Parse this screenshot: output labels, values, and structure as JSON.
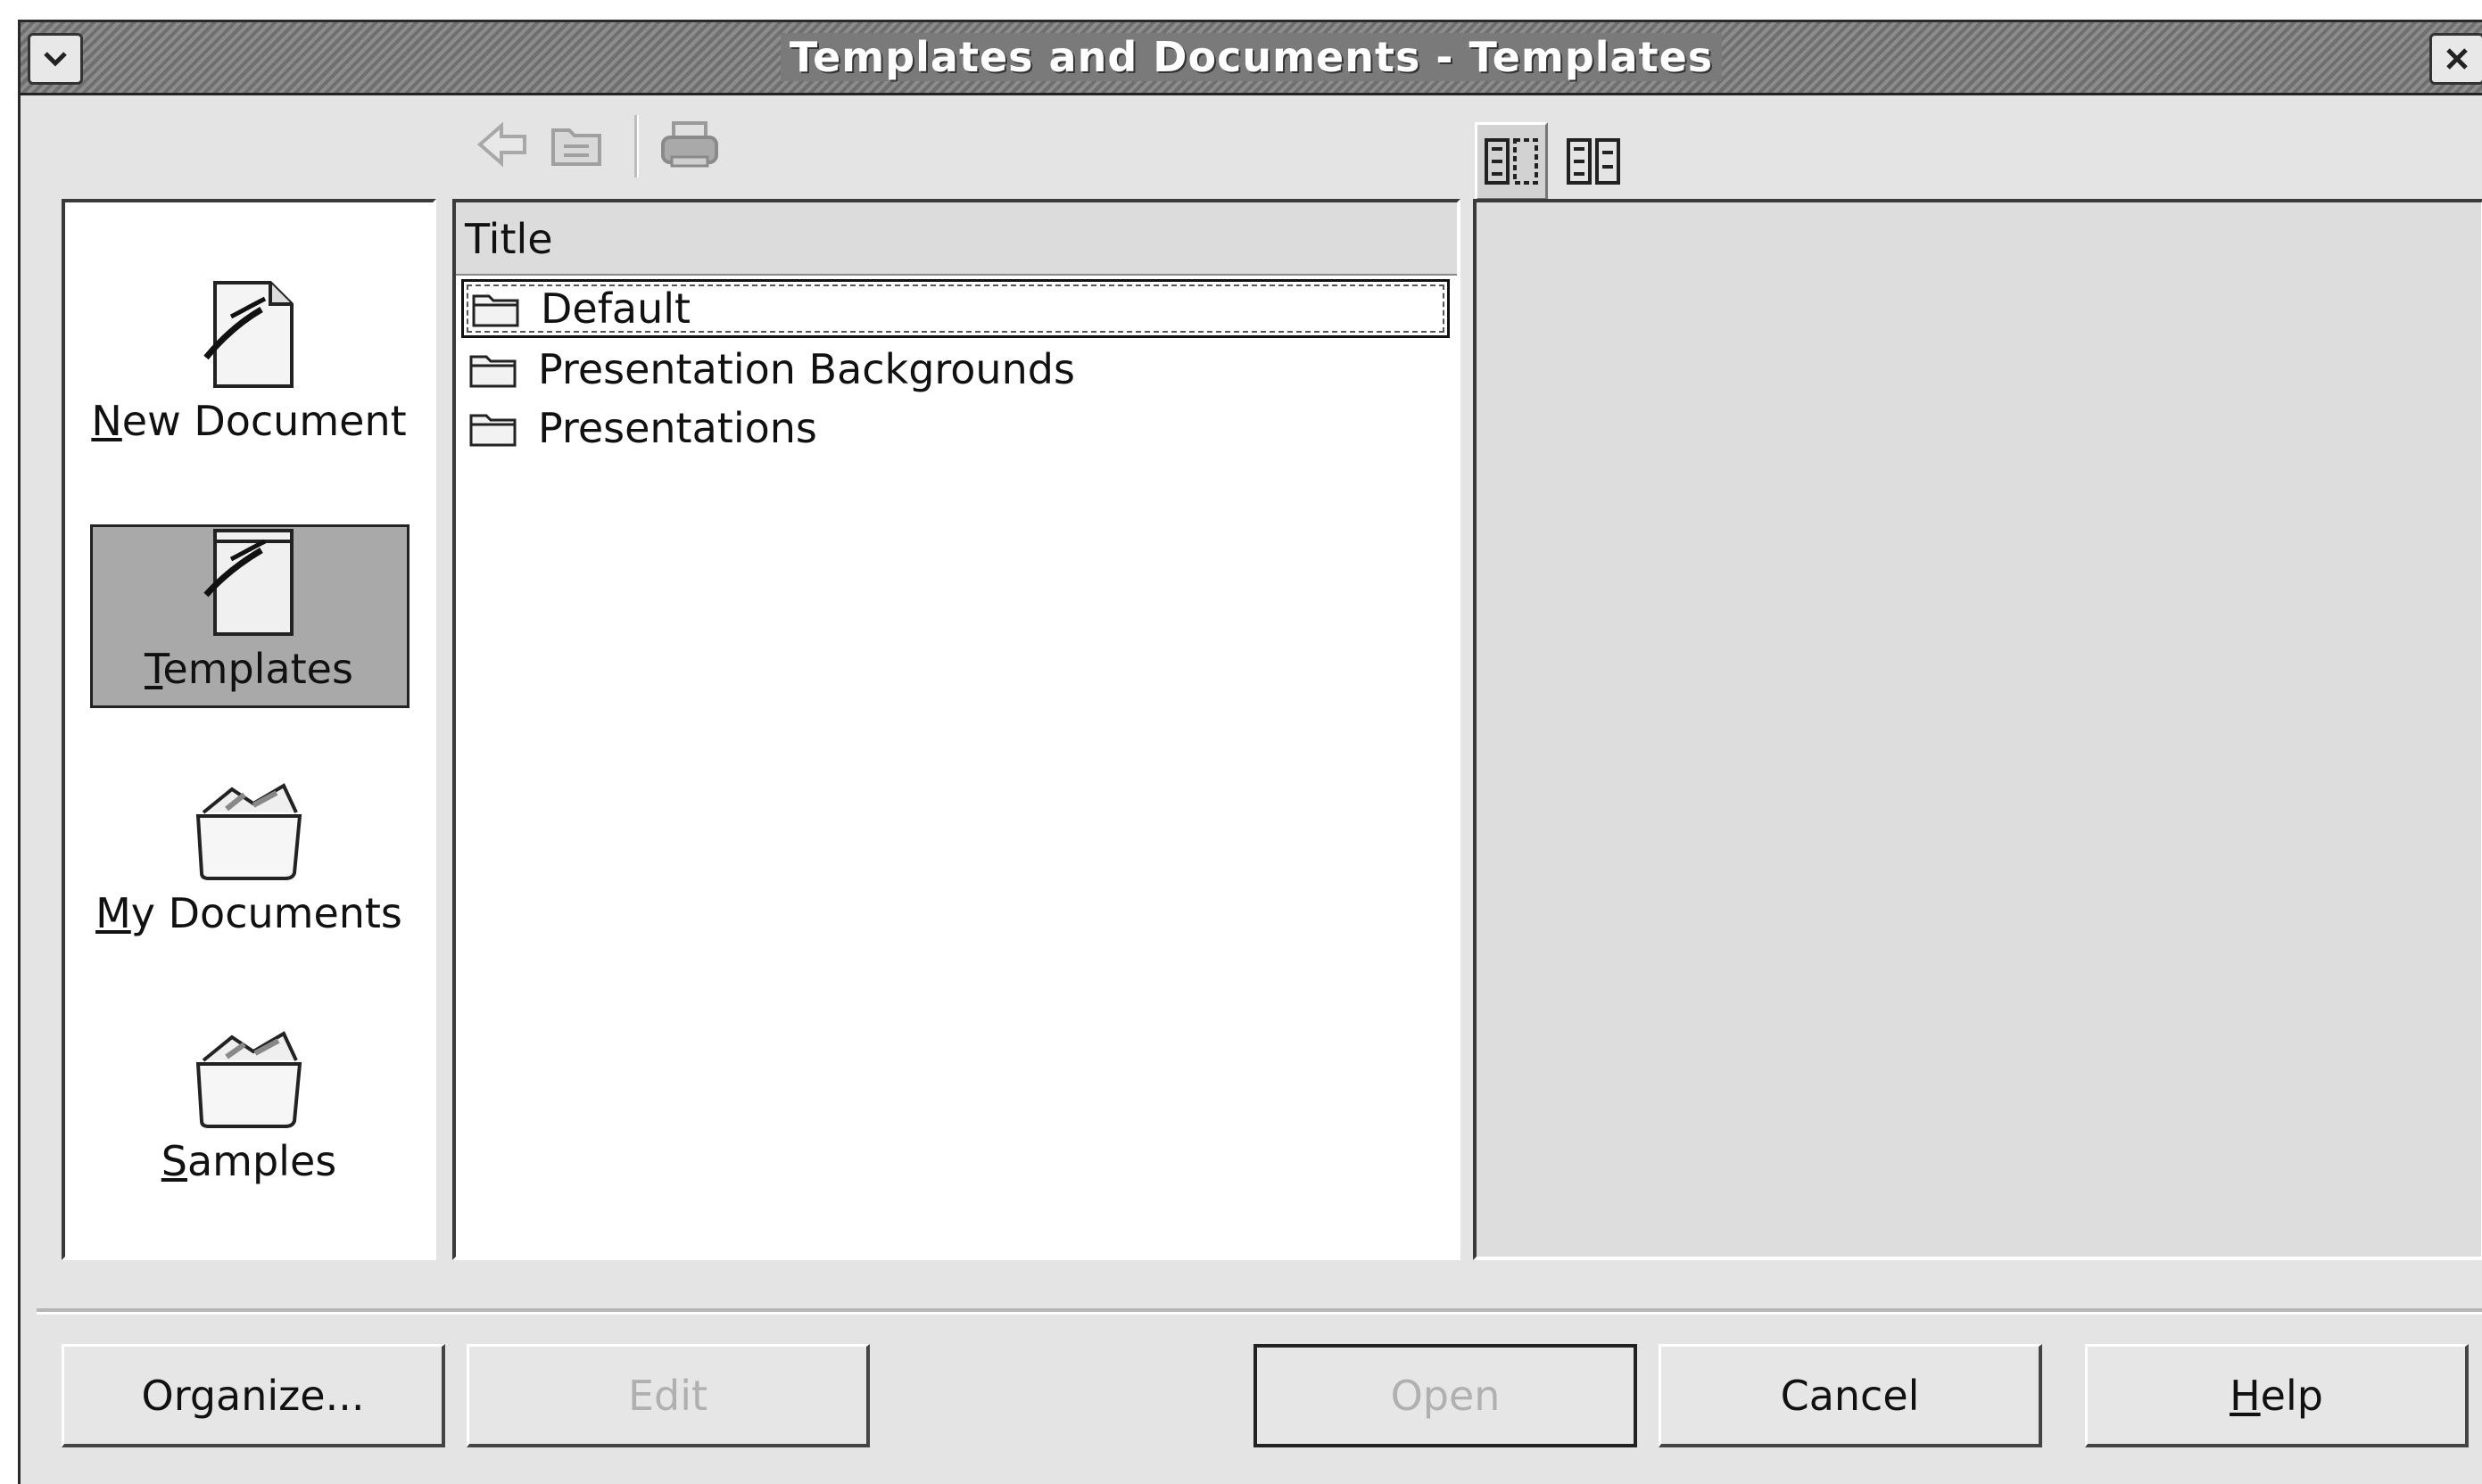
{
  "window": {
    "title": "Templates and Documents - Templates",
    "menu_icon": "chevron-down-icon",
    "close_icon": "close-icon"
  },
  "toolbar": {
    "icons": [
      "back-arrow-icon",
      "up-folder-icon",
      "print-icon"
    ],
    "view_icons": [
      "document-preview-icon",
      "document-properties-icon"
    ]
  },
  "nav": {
    "items": [
      {
        "label_first": "N",
        "label_rest": "ew Document",
        "icon": "new-document-icon"
      },
      {
        "label_first": "T",
        "label_rest": "emplates",
        "icon": "templates-icon"
      },
      {
        "label_first": "M",
        "label_rest": "y Documents",
        "icon": "my-documents-icon"
      },
      {
        "label_first": "S",
        "label_rest": "amples",
        "icon": "samples-icon"
      }
    ],
    "selected": "Templates"
  },
  "list": {
    "column_header": "Title",
    "rows": [
      {
        "label": "Default",
        "icon": "folder-icon"
      },
      {
        "label": "Presentation Backgrounds",
        "icon": "folder-icon"
      },
      {
        "label": "Presentations",
        "icon": "folder-icon"
      }
    ]
  },
  "buttons": {
    "organize": "Organize...",
    "edit": "Edit",
    "open": "Open",
    "cancel": "Cancel",
    "help": "Help"
  },
  "colors": {
    "window_bg": "#e4e4e4",
    "selection_bg": "#a9a9a9",
    "disabled_text": "#b0b0b0"
  }
}
